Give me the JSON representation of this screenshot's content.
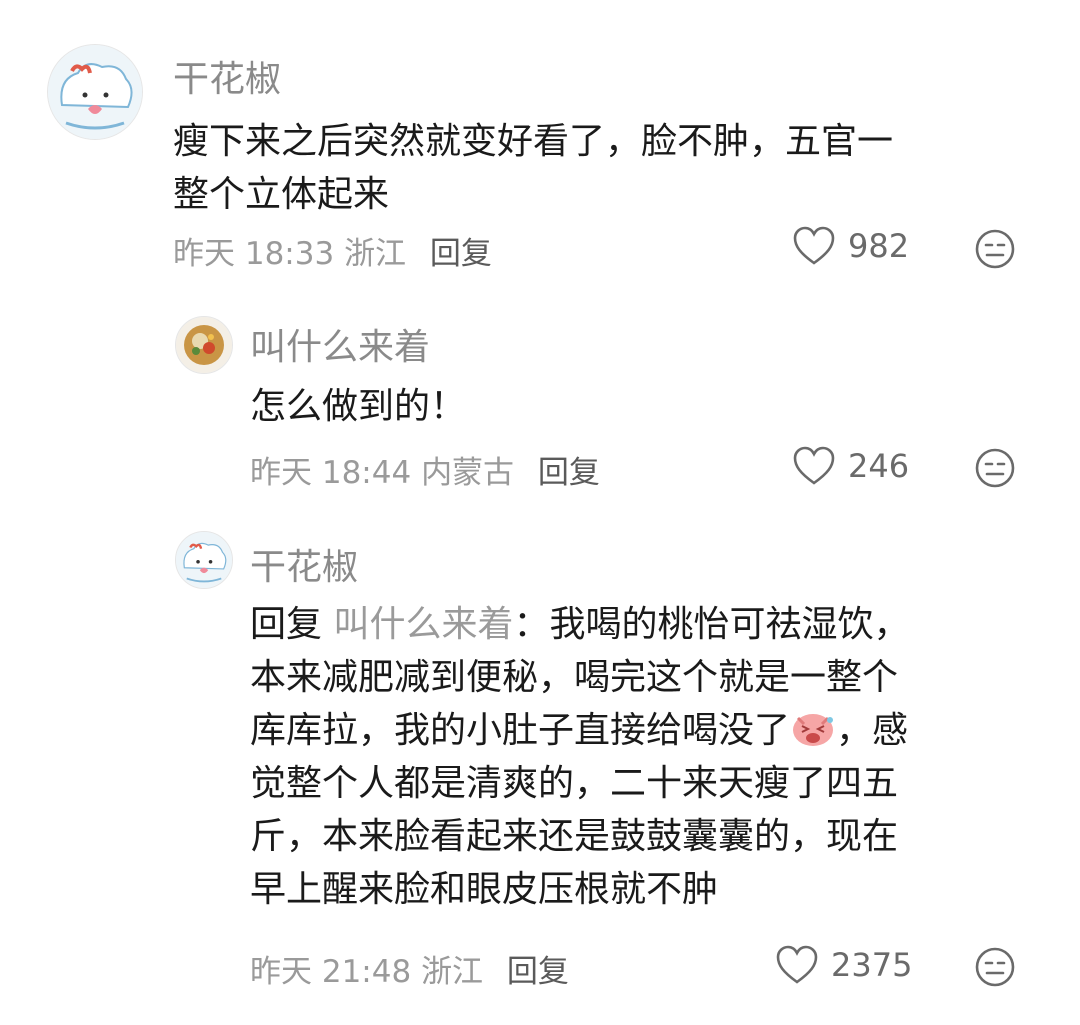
{
  "comments": [
    {
      "username": "干花椒",
      "lines": [
        "瘦下来之后突然就变好看了，脸不肿，五官一",
        "整个立体起来"
      ],
      "time": "昨天 18:33",
      "location": "浙江",
      "reply_label": "回复",
      "likes": "982"
    },
    {
      "username": "叫什么来着",
      "lines": [
        "怎么做到的！"
      ],
      "time": "昨天 18:44",
      "location": "内蒙古",
      "reply_label": "回复",
      "likes": "246"
    },
    {
      "username": "干花椒",
      "reply_prefix": "回复",
      "reply_target": "叫什么来着",
      "line1_text": "：我喝的桃怡可祛湿饮，",
      "line2": "本来减肥减到便秘，喝完这个就是一整个",
      "line3_before": "库库拉，我的小肚子直接给喝没了",
      "line3_after": "，感",
      "line4": "觉整个人都是清爽的，二十来天瘦了四五",
      "line5": "斤，本来脸看起来还是鼓鼓囊囊的，现在",
      "line6": "早上醒来脸和眼皮压根就不肿",
      "time": "昨天 21:48",
      "location": "浙江",
      "reply_label": "回复",
      "likes": "2375",
      "inline_emoji": "laughing-pig-emoji"
    }
  ],
  "icons": {
    "like": "heart-outline-icon",
    "emoji": "neutral-face-icon"
  },
  "colors": {
    "username": "#8a8a8a",
    "meta": "#9a9a9a",
    "text": "#1a1a1a"
  }
}
